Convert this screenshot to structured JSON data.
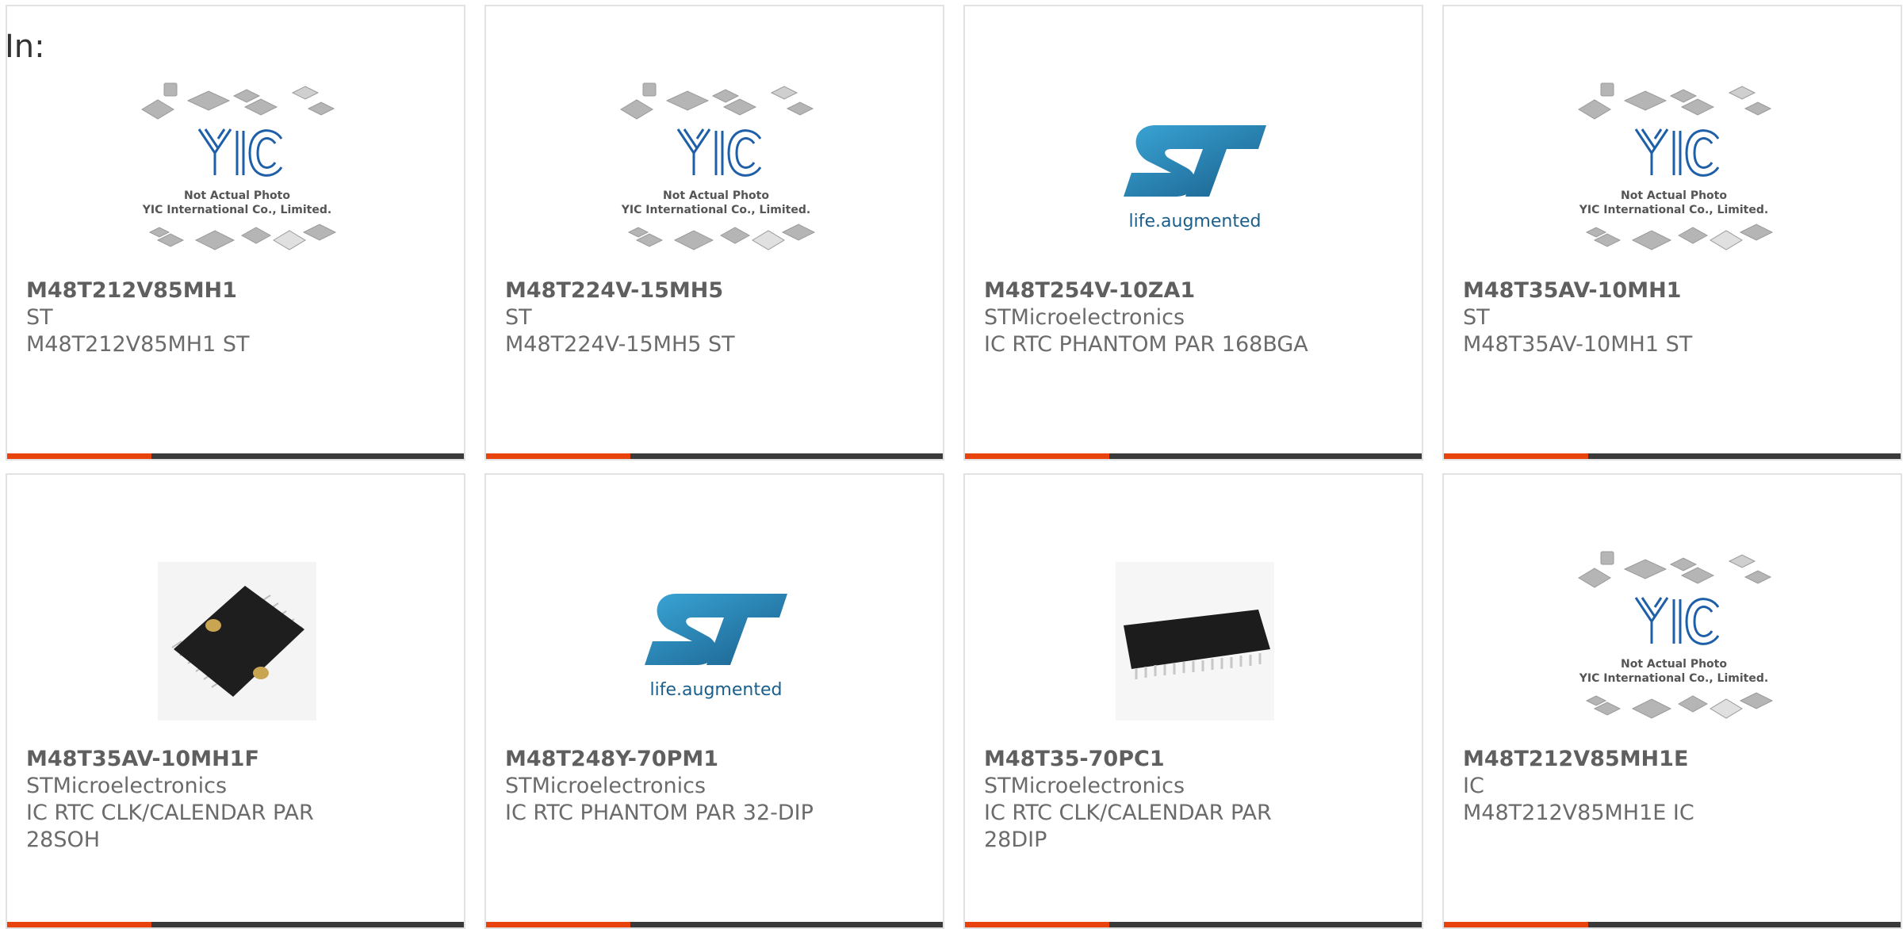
{
  "header": {
    "in_label": "In:"
  },
  "placeholder": {
    "line1": "Not Actual Photo",
    "line2": "YIC International Co., Limited.",
    "logo_text": "YIC"
  },
  "st_logo": {
    "tagline": "life.augmented"
  },
  "accent_color": "#e8430d",
  "bar_color": "#3a3a3a",
  "products": [
    {
      "part": "M48T212V85MH1",
      "brand": "ST",
      "desc": [
        "M48T212V85MH1 ST"
      ],
      "image": "yic-placeholder"
    },
    {
      "part": "M48T224V-15MH5",
      "brand": "ST",
      "desc": [
        "M48T224V-15MH5 ST"
      ],
      "image": "yic-placeholder"
    },
    {
      "part": "M48T254V-10ZA1",
      "brand": "STMicroelectronics",
      "desc": [
        "IC RTC PHANTOM PAR 168BGA"
      ],
      "image": "st-logo"
    },
    {
      "part": "M48T35AV-10MH1",
      "brand": "ST",
      "desc": [
        "M48T35AV-10MH1 ST"
      ],
      "image": "yic-placeholder"
    },
    {
      "part": "M48T35AV-10MH1F",
      "brand": "STMicroelectronics",
      "desc": [
        "IC RTC CLK/CALENDAR PAR",
        "28SOH"
      ],
      "image": "soh-chip-photo"
    },
    {
      "part": "M48T248Y-70PM1",
      "brand": "STMicroelectronics",
      "desc": [
        "IC RTC PHANTOM PAR 32-DIP"
      ],
      "image": "st-logo"
    },
    {
      "part": "M48T35-70PC1",
      "brand": "STMicroelectronics",
      "desc": [
        "IC RTC CLK/CALENDAR PAR",
        "28DIP"
      ],
      "image": "dip-chip-photo"
    },
    {
      "part": "M48T212V85MH1E",
      "brand": "IC",
      "desc": [
        "M48T212V85MH1E IC"
      ],
      "image": "yic-placeholder"
    }
  ]
}
